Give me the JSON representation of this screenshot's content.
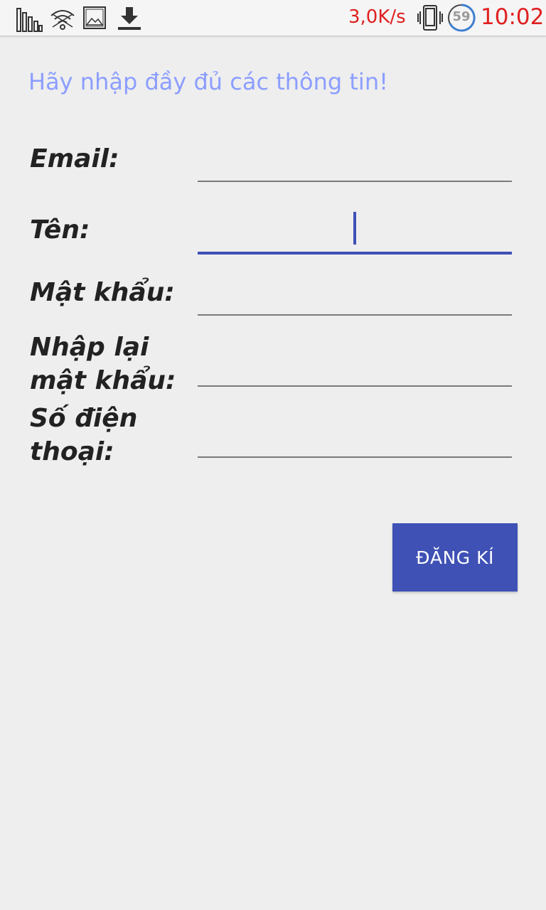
{
  "status_bar": {
    "icons": [
      "signal-bars-icon",
      "wifi-icon",
      "image-icon",
      "download-icon"
    ],
    "net_speed": "3,0K/s",
    "battery_level": "59",
    "time": "10:02",
    "colors": {
      "alert_text": "#e02020"
    }
  },
  "form": {
    "heading": "Hãy nhập đầy đủ các thông tin!",
    "fields": [
      {
        "label": "Email:",
        "value": ""
      },
      {
        "label": "Tên:",
        "value": "",
        "focused": true
      },
      {
        "label": "Mật khẩu:",
        "value": ""
      },
      {
        "label": "Nhập lại mật khẩu:",
        "value": ""
      },
      {
        "label": "Số điện thoại:",
        "value": ""
      }
    ],
    "submit_label": "ĐĂNG KÍ"
  },
  "colors": {
    "accent": "#3f51b5",
    "heading": "#8c9eff",
    "background": "#eeeeee"
  }
}
